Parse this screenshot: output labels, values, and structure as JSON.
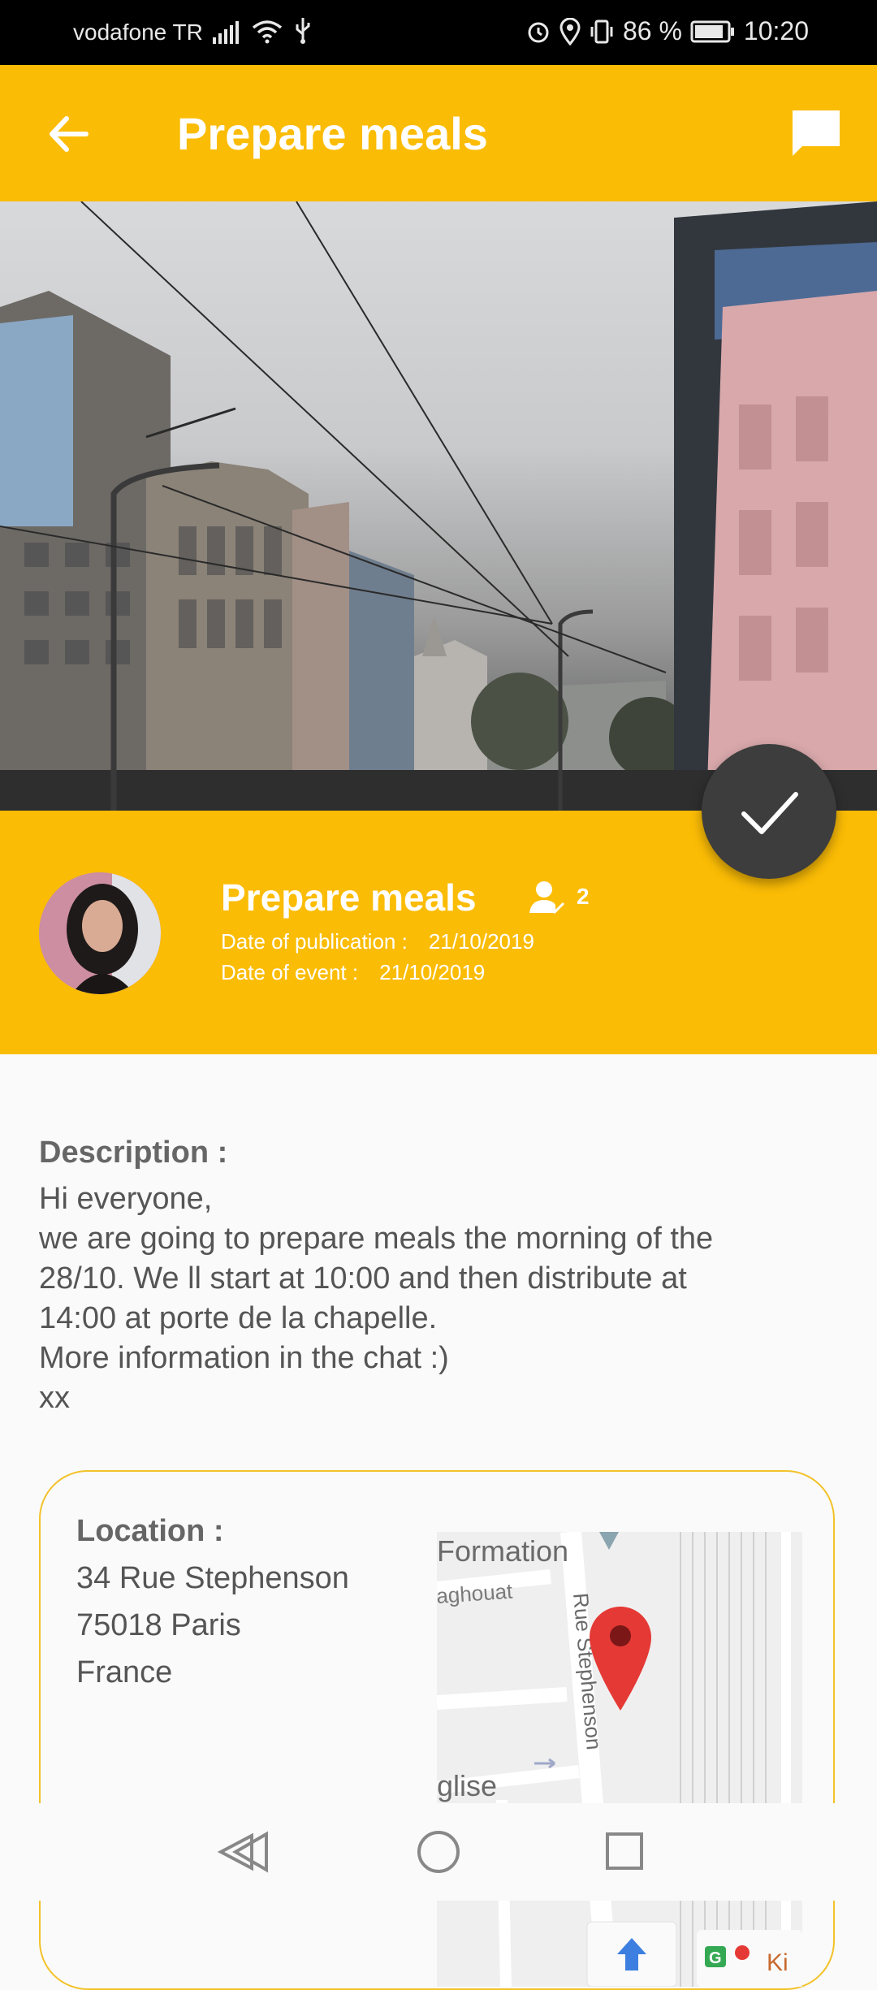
{
  "status_bar": {
    "carrier": "vodafone TR",
    "battery": "86 %",
    "time": "10:20"
  },
  "app_bar": {
    "title": "Prepare meals"
  },
  "event": {
    "title": "Prepare meals",
    "participants_count": "2",
    "publication_label": "Date of publication :",
    "publication_date": "21/10/2019",
    "event_label": "Date of event :",
    "event_date": "21/10/2019"
  },
  "description": {
    "label": "Description :",
    "lines": [
      "Hi everyone,",
      "we are going to prepare meals the morning of the",
      "28/10. We ll start at 10:00 and then distribute at",
      "14:00 at porte de la chapelle.",
      "More information in the chat :)",
      "xx"
    ]
  },
  "location": {
    "label": "Location :",
    "street": "34 Rue Stephenson",
    "city": "75018 Paris",
    "country": "France",
    "map_labels": {
      "top": "Formation",
      "street1": "aghouat",
      "street2": "Rue Stephenson",
      "bottom": "glise",
      "corner": "Ki"
    }
  },
  "colors": {
    "accent": "#fbbc05",
    "fab": "#3d3d3d",
    "pin": "#e53935"
  },
  "icons": {
    "back": "arrow-left-icon",
    "chat": "chat-bubble-icon",
    "check": "check-icon",
    "participants": "person-check-icon"
  }
}
